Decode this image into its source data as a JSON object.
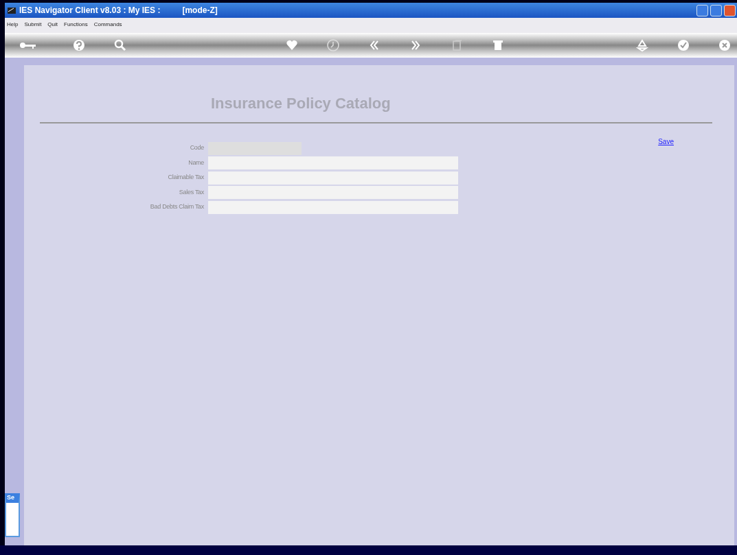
{
  "window": {
    "title": "IES Navigator Client v8.03 : My IES :",
    "mode": "[mode-Z]"
  },
  "menu": [
    "Help",
    "Submit",
    "Quit",
    "Functions",
    "Commands"
  ],
  "form": {
    "title": "Insurance Policy Catalog",
    "save_link": "Save",
    "fields": [
      {
        "label": "Code",
        "disabled": true
      },
      {
        "label": "Name",
        "disabled": false
      },
      {
        "label": "Claimable Tax",
        "disabled": false
      },
      {
        "label": "Sales Tax",
        "disabled": false
      },
      {
        "label": "Bad Debts Claim Tax",
        "disabled": false
      }
    ]
  },
  "side_panel": {
    "title": "Se"
  }
}
